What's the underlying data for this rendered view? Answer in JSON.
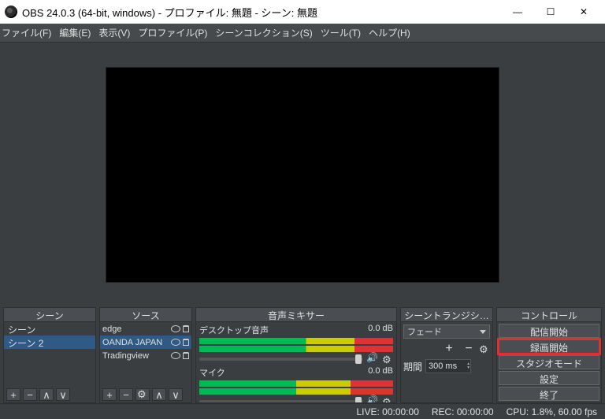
{
  "window": {
    "title": "OBS 24.0.3 (64-bit, windows) - プロファイル: 無題 - シーン: 無題"
  },
  "menu": {
    "file": "ファイル(F)",
    "edit": "編集(E)",
    "view": "表示(V)",
    "profile": "プロファイル(P)",
    "sceneCollection": "シーンコレクション(S)",
    "tools": "ツール(T)",
    "help": "ヘルプ(H)"
  },
  "docks": {
    "scenes": {
      "title": "シーン"
    },
    "sources": {
      "title": "ソース"
    },
    "mixer": {
      "title": "音声ミキサー"
    },
    "transitions": {
      "title": "シーントランジシ…"
    },
    "controls": {
      "title": "コントロール"
    }
  },
  "scenes": {
    "items": [
      {
        "label": "シーン"
      },
      {
        "label": "シーン 2"
      }
    ]
  },
  "sources": {
    "items": [
      {
        "label": "edge"
      },
      {
        "label": "OANDA JAPAN"
      },
      {
        "label": "Tradingview"
      }
    ]
  },
  "mixer": {
    "channels": [
      {
        "name": "デスクトップ音声",
        "level": "0.0 dB"
      },
      {
        "name": "マイク",
        "level": "0.0 dB"
      }
    ]
  },
  "transitions": {
    "selected": "フェード",
    "durationLabel": "期間",
    "durationValue": "300 ms"
  },
  "controls": {
    "startStream": "配信開始",
    "startRecord": "録画開始",
    "studioMode": "スタジオモード",
    "settings": "設定",
    "exit": "終了"
  },
  "status": {
    "live": "LIVE: 00:00:00",
    "rec": "REC: 00:00:00",
    "cpu": "CPU: 1.8%, 60.00 fps"
  }
}
